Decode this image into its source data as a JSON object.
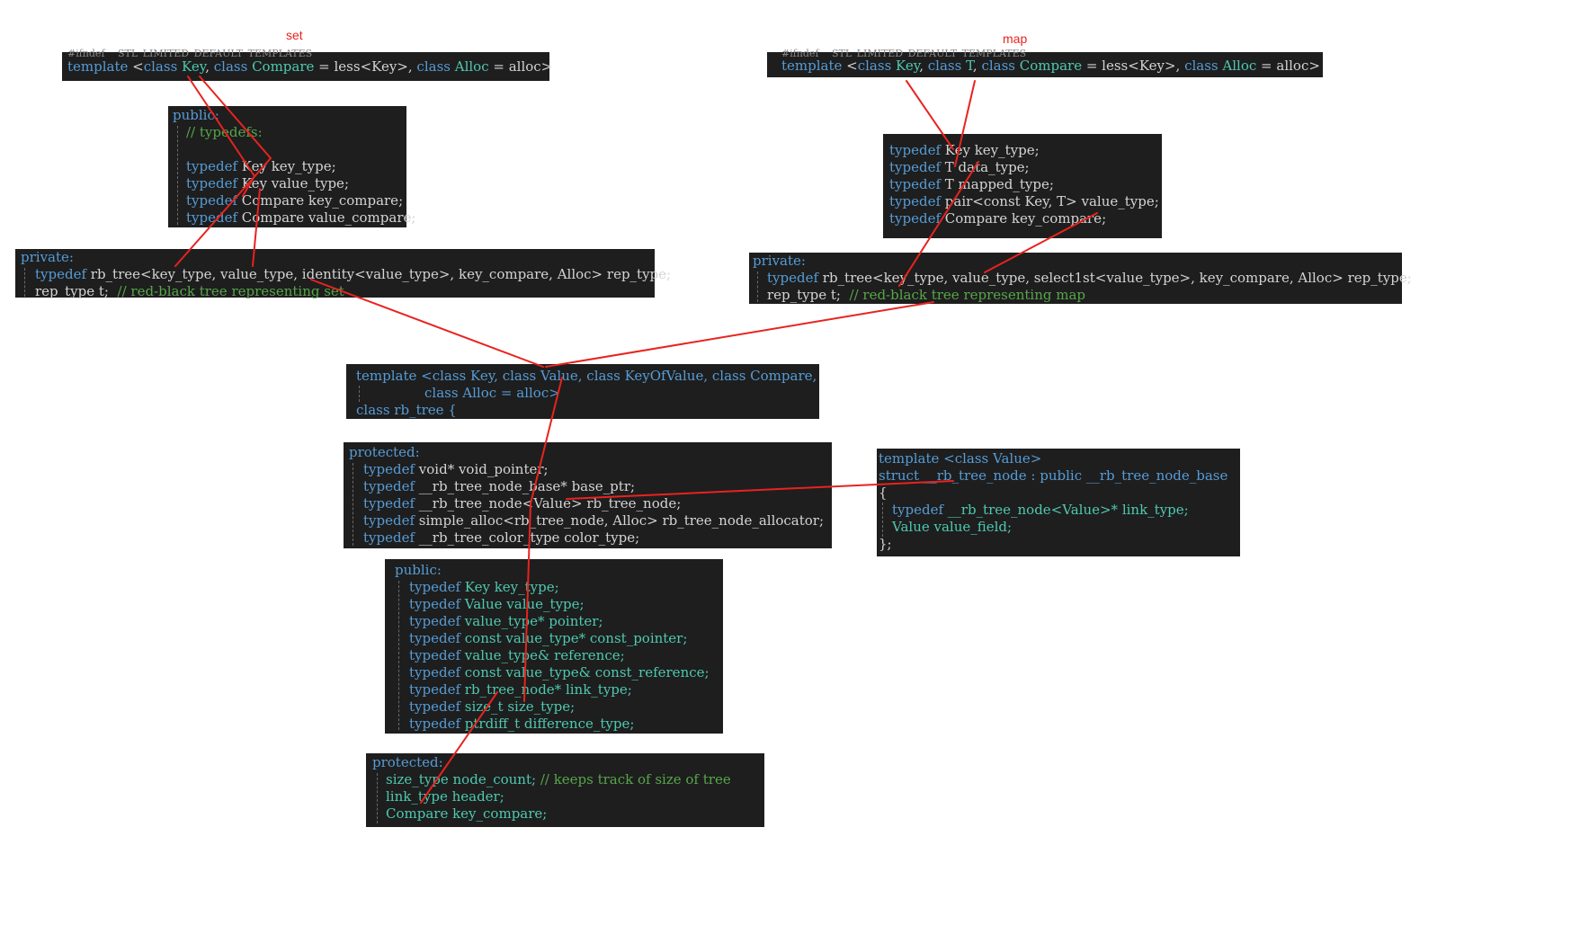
{
  "labels": {
    "set": "set",
    "map": "map"
  },
  "set_template": {
    "kw1": "template",
    "p1": " <",
    "kw2": "class",
    "t1": " Key",
    "p2": ", ",
    "kw3": "class",
    "t2": " Compare",
    "p3": " = less<Key>, ",
    "kw4": "class",
    "t3": " Alloc",
    "p4": " = alloc>"
  },
  "set_public": {
    "header": "public:",
    "comment": "// typedefs:",
    "lines": [
      {
        "kw": "typedef",
        "rest": " Key key_type;"
      },
      {
        "kw": "typedef",
        "rest": " Key value_type;"
      },
      {
        "kw": "typedef",
        "rest": " Compare key_compare;"
      },
      {
        "kw": "typedef",
        "rest": " Compare value_compare;"
      }
    ]
  },
  "set_private": {
    "header": "private:",
    "line1_kw": "typedef",
    "line1_rest": " rb_tree<key_type, value_type, identity<value_type>, key_compare, Alloc> rep_type;",
    "line2_code": "rep_type t;",
    "line2_comment": "// red-black tree representing set"
  },
  "map_template": {
    "kw1": "template",
    "p1": " <",
    "kw2": "class",
    "t1": " Key",
    "p2": ", ",
    "kw3": "class",
    "t2": " T",
    "p3": ", ",
    "kw4": "class",
    "t3": " Compare",
    "p4": " = less<Key>, ",
    "kw5": "class",
    "t4": " Alloc",
    "p5": " = alloc>"
  },
  "map_typedefs": [
    {
      "kw": "typedef",
      "rest": " Key key_type;"
    },
    {
      "kw": "typedef",
      "rest": " T data_type;"
    },
    {
      "kw": "typedef",
      "rest": " T mapped_type;"
    },
    {
      "kw": "typedef",
      "rest": " pair<const Key, T> value_type;"
    },
    {
      "kw": "typedef",
      "rest": " Compare key_compare;"
    }
  ],
  "map_private": {
    "header": "private:",
    "line1_kw": "typedef",
    "line1_rest": " rb_tree<key_type, value_type, select1st<value_type>, key_compare, Alloc> rep_type;",
    "line2_code": "rep_type t;",
    "line2_comment": "// red-black tree representing map"
  },
  "rb_template": {
    "line1": "template <class Key, class Value, class KeyOfValue, class Compare,",
    "line2": "class Alloc = alloc>",
    "line3": "class rb_tree {"
  },
  "rb_protected": {
    "header": "protected:",
    "lines": [
      {
        "kw": "typedef",
        "rest": " void* void_pointer;"
      },
      {
        "kw": "typedef",
        "rest": " __rb_tree_node_base* base_ptr;"
      },
      {
        "kw": "typedef",
        "rest": " __rb_tree_node<Value> rb_tree_node;"
      },
      {
        "kw": "typedef",
        "rest": " simple_alloc<rb_tree_node, Alloc> rb_tree_node_allocator;"
      },
      {
        "kw": "typedef",
        "rest": " __rb_tree_color_type color_type;"
      }
    ]
  },
  "rb_public": {
    "header": "public:",
    "lines": [
      {
        "kw": "typedef",
        "rest": " Key key_type;"
      },
      {
        "kw": "typedef",
        "rest": " Value value_type;"
      },
      {
        "kw": "typedef",
        "rest": " value_type* pointer;"
      },
      {
        "kw": "typedef",
        "rest": " const value_type* const_pointer;"
      },
      {
        "kw": "typedef",
        "rest": " value_type& reference;"
      },
      {
        "kw": "typedef",
        "rest": " const value_type& const_reference;"
      },
      {
        "kw": "typedef",
        "rest": " rb_tree_node* link_type;"
      },
      {
        "kw": "typedef",
        "rest": " size_t size_type;"
      },
      {
        "kw": "typedef",
        "rest": " ptrdiff_t difference_type;"
      }
    ]
  },
  "rb_members": {
    "header": "protected:",
    "line1_code": "size_type node_count;",
    "line1_comment": "// keeps track of size of tree",
    "line2": "link_type header;",
    "line3": "Compare key_compare;"
  },
  "node_struct": {
    "line1": "template <class Value>",
    "line2": "struct __rb_tree_node : public __rb_tree_node_base",
    "line3": "{",
    "line4_kw": "typedef",
    "line4_rest": " __rb_tree_node<Value>* link_type;",
    "line5": "Value value_field;",
    "line6": "};"
  },
  "colors": {
    "line": "#e8231f",
    "background": "#1e1e1e",
    "keyword": "#569cd6",
    "type": "#4ec9b0",
    "comment": "#57a64a",
    "text": "#d4d4d4"
  }
}
